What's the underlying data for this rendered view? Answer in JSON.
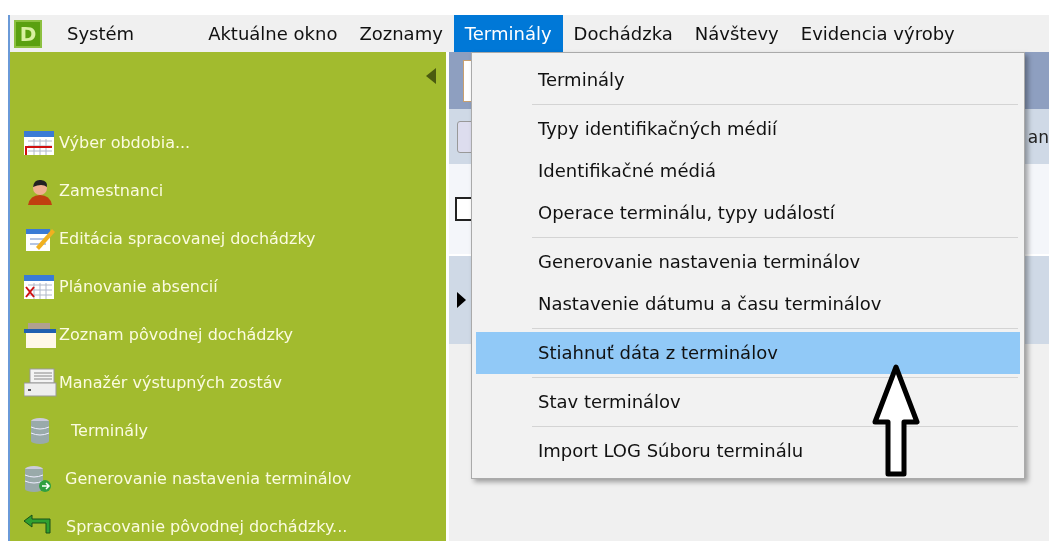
{
  "menubar": {
    "logo": "D",
    "items": [
      {
        "label": "Systém",
        "selected": false
      },
      {
        "label": "Aktuálne okno",
        "selected": false
      },
      {
        "label": "Zoznamy",
        "selected": false
      },
      {
        "label": "Terminály",
        "selected": true
      },
      {
        "label": "Dochádzka",
        "selected": false
      },
      {
        "label": "Návštevy",
        "selected": false
      },
      {
        "label": "Evidencia výroby",
        "selected": false
      }
    ]
  },
  "sidebar": {
    "items": [
      {
        "label": "Výber obdobia..."
      },
      {
        "label": "Zamestnanci"
      },
      {
        "label": "Editácia spracovanej dochádzky"
      },
      {
        "label": "Plánovanie absencií"
      },
      {
        "label": "Zoznam pôvodnej dochádzky"
      },
      {
        "label": "Manažér výstupných zostáv"
      },
      {
        "label": "Terminály"
      },
      {
        "label": "Generovanie nastavenia terminálov"
      },
      {
        "label": "Spracovanie pôvodnej dochádzky..."
      }
    ]
  },
  "background": {
    "column_header": "an",
    "checkbox": {
      "checked": false
    }
  },
  "dropdown": {
    "groups": [
      [
        {
          "label": "Terminály",
          "selected": false
        }
      ],
      [
        {
          "label": "Typy identifikačných médií",
          "selected": false
        },
        {
          "label": "Identifikačné médiá",
          "selected": false
        },
        {
          "label": "Operace terminálu, typy událostí",
          "selected": false
        }
      ],
      [
        {
          "label": "Generovanie nastavenia terminálov",
          "selected": false
        },
        {
          "label": "Nastavenie dátumu a času terminálov",
          "selected": false
        }
      ],
      [
        {
          "label": "Stiahnuť dáta z terminálov",
          "selected": true
        }
      ],
      [
        {
          "label": "Stav terminálov",
          "selected": false
        }
      ],
      [
        {
          "label": "Import LOG Súboru terminálu",
          "selected": false
        }
      ]
    ]
  }
}
